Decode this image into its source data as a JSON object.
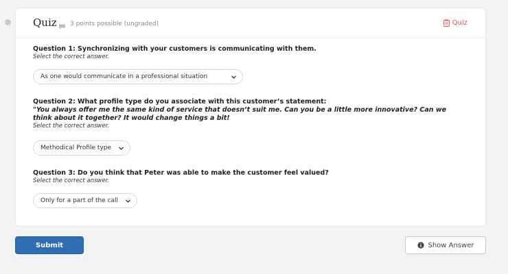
{
  "header": {
    "title": "Quiz",
    "points": "3 points possible (ungraded)",
    "tag": "Quiz"
  },
  "questions": [
    {
      "title": "Question 1: Synchronizing with your customers is communicating with them.",
      "hint": "Select the correct answer.",
      "selected": "As one would communicate in a professional situation"
    },
    {
      "title": "Question 2: What profile type do you associate with this customer’s statement:",
      "quote": "\"You always offer me the same kind of service that doesn’t suit me. Can you be a little more innovative? Can we think about it together? It would change things a bit!",
      "hint": "Select the correct answer.",
      "selected": "Methodical Profile type"
    },
    {
      "title": "Question 3: Do you think that Peter was able to make the customer feel valued?",
      "hint": "Select the correct answer.",
      "selected": "Only for a part of the call"
    }
  ],
  "actions": {
    "submit": "Submit",
    "show_answer": "Show Answer"
  },
  "colors": {
    "accent": "#2f6db5",
    "tag": "#d9534f"
  }
}
